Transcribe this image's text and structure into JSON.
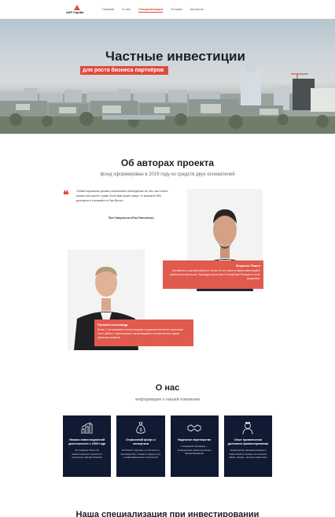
{
  "nav": {
    "logo": "AdP Capital",
    "items": [
      {
        "label": "Главная",
        "active": false
      },
      {
        "label": "О нас",
        "active": false
      },
      {
        "label": "Специализация",
        "active": true
      },
      {
        "label": "Отзывы",
        "active": false
      },
      {
        "label": "Контакты",
        "active": false
      }
    ]
  },
  "hero": {
    "title": "Частные инвестиции",
    "subtitle": "для роста бизнеса партнёров"
  },
  "authors": {
    "title": "Об авторах проекта",
    "subtitle": "фонд сформирован в 2019 году из средств двух основателей",
    "quote": "«Инвестирование должно напоминать наблюдение за тем, как сохнет краска или растет трава. Если вам нужен азарт, то возьмите 800 долларов и поезжайте в Лас-Вегас»",
    "quote_author": "Пол Самуэльсон (Paul Samuelson)",
    "person1": {
      "name": "Борисов Павел",
      "desc": "Основатель и частный инвестор. Более 10 лет опыта в сфере инвестиций и управления капиталом. Руководил проектами в Республике Беларусь и за её пределами."
    },
    "person2": {
      "name": "Пугачёв Александр",
      "desc": "Более 7 лет занимается инвестициями и управлением бизнес-проектами. Опыт работы с финансовыми организациями и консалтингом в сфере развития компаний."
    }
  },
  "about": {
    "title": "О нас",
    "subtitle": "информация о нашей компании",
    "features": [
      {
        "icon": "chart-growth-icon",
        "title": "Начало инвестиционной деятельности с 2009 года",
        "desc": "В портфеле более 20 инвестиционных проектов в различных сферах бизнеса"
      },
      {
        "icon": "money-bag-icon",
        "title": "Отраслевой фокус и экспертиза",
        "desc": "В области торговли, e-commerce и производства, а также в сфере услуг и информационных технологий"
      },
      {
        "icon": "handshake-icon",
        "title": "Надежное партнерство",
        "desc": "У компаний партнёров — проверенные инвестиционные финансирования"
      },
      {
        "icon": "advisor-icon",
        "title": "Опыт привлечения долгового финансирования",
        "desc": "Привлечение финансирования и инвестиций из разных источников: банки, фонды, частные инвесторы"
      }
    ]
  },
  "next_section": {
    "title": "Наша специализация при инвестировании"
  }
}
